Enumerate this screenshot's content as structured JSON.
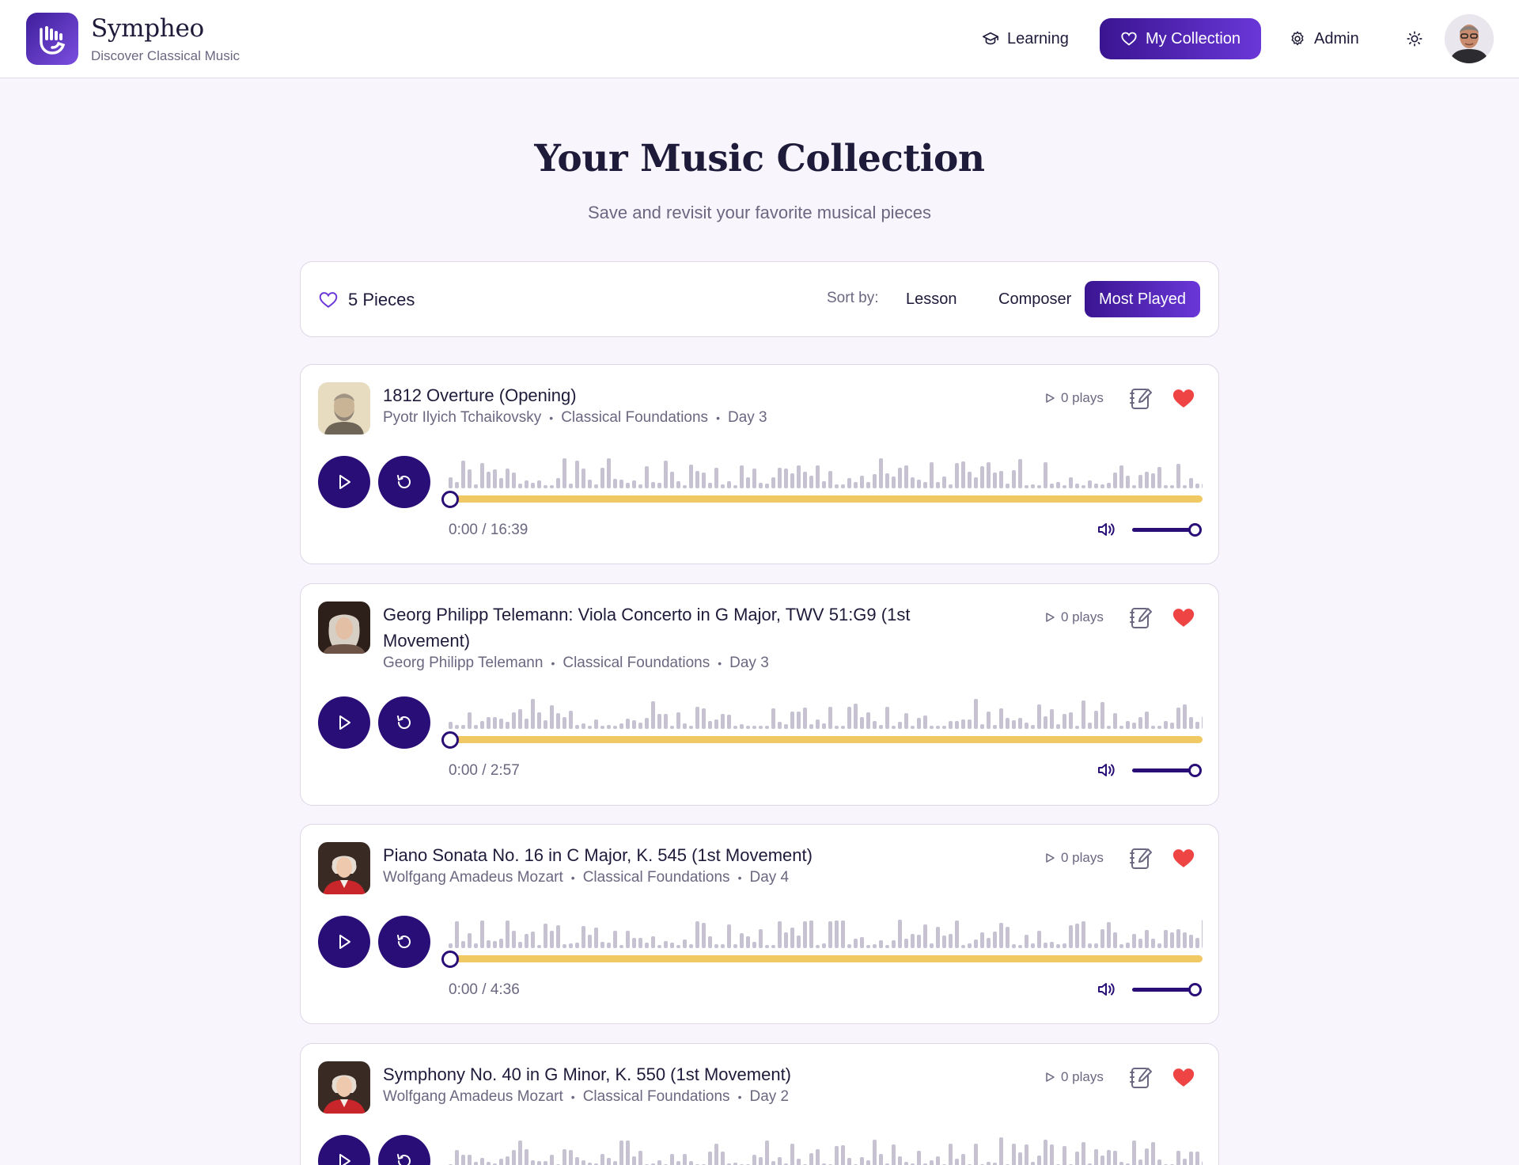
{
  "app": {
    "name": "Sympheo",
    "tagline": "Discover Classical Music"
  },
  "nav": {
    "learning": "Learning",
    "collection": "My Collection",
    "admin": "Admin",
    "theme_icon": "sun-icon",
    "avatar_icon": "user-avatar"
  },
  "page": {
    "title": "Your Music Collection",
    "subtitle": "Save and revisit your favorite musical pieces"
  },
  "collection": {
    "count_label": "5 Pieces",
    "sort_label": "Sort by:",
    "sort_options": [
      "Lesson",
      "Composer",
      "Most Played"
    ],
    "active_sort": "Most Played"
  },
  "colors": {
    "brand": "#3a1591",
    "accent": "#6a37d8",
    "player": "#2a0e78",
    "progress": "#f0c964",
    "heart": "#ef4444",
    "waveform": "#c6c2d2"
  },
  "pieces": [
    {
      "title": "1812 Overture (Opening)",
      "composer": "Pyotr Ilyich Tchaikovsky",
      "lesson": "Classical Foundations",
      "day": "Day 3",
      "plays": "0 plays",
      "time": "0:00 / 16:39",
      "favorited": true,
      "progress": 0,
      "volume": 1
    },
    {
      "title": "Georg Philipp Telemann: Viola Concerto in G Major, TWV 51:G9 (1st Movement)",
      "composer": "Georg Philipp Telemann",
      "lesson": "Classical Foundations",
      "day": "Day 3",
      "plays": "0 plays",
      "time": "0:00 / 2:57",
      "favorited": true,
      "progress": 0,
      "volume": 1
    },
    {
      "title": "Piano Sonata No. 16 in C Major, K. 545 (1st Movement)",
      "composer": "Wolfgang Amadeus Mozart",
      "lesson": "Classical Foundations",
      "day": "Day 4",
      "plays": "0 plays",
      "time": "0:00 / 4:36",
      "favorited": true,
      "progress": 0,
      "volume": 1
    },
    {
      "title": "Symphony No. 40 in G Minor, K. 550 (1st Movement)",
      "composer": "Wolfgang Amadeus Mozart",
      "lesson": "Classical Foundations",
      "day": "Day 2",
      "plays": "0 plays",
      "time": "",
      "favorited": true,
      "progress": 0,
      "volume": 1
    }
  ]
}
